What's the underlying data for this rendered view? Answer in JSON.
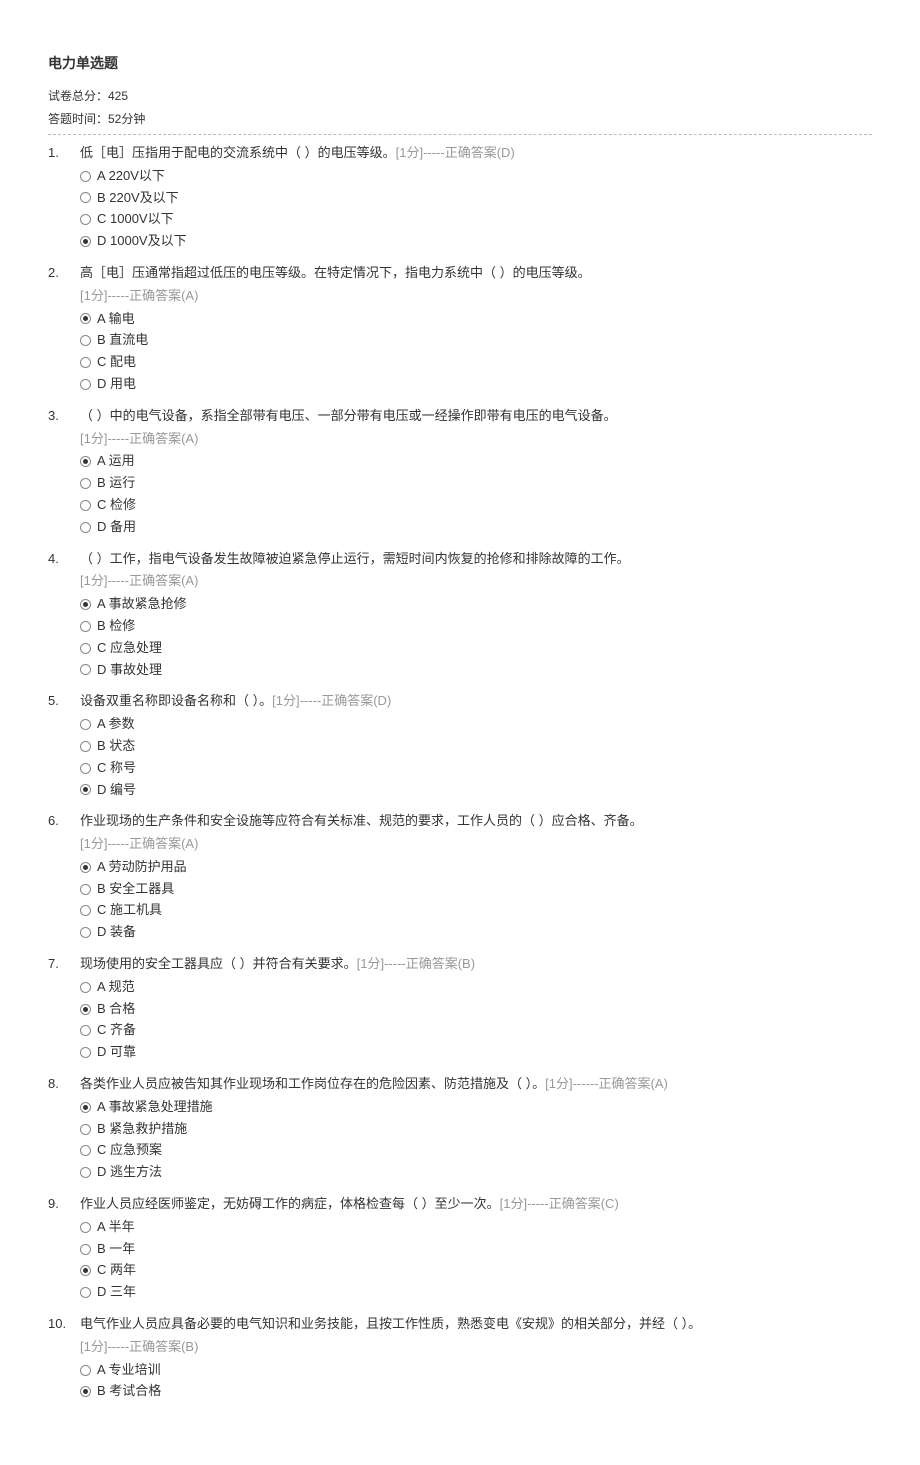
{
  "title": "电力单选题",
  "meta": {
    "total_score_label": "试卷总分：425",
    "time_label": "答题时间：52分钟"
  },
  "questions": [
    {
      "num": "1.",
      "stem": "低［电］压指用于配电的交流系统中（  ）的电压等级。",
      "answer": "[1分]-----正确答案(D)",
      "answer_inline": true,
      "options": [
        {
          "letter": "A",
          "text": "220V以下",
          "selected": false
        },
        {
          "letter": "B",
          "text": "220V及以下",
          "selected": false
        },
        {
          "letter": "C",
          "text": "1000V以下",
          "selected": false
        },
        {
          "letter": "D",
          "text": "1000V及以下",
          "selected": true
        }
      ]
    },
    {
      "num": "2.",
      "stem": "高［电］压通常指超过低压的电压等级。在特定情况下，指电力系统中（  ）的电压等级。",
      "answer": "[1分]-----正确答案(A)",
      "answer_inline": false,
      "options": [
        {
          "letter": "A",
          "text": "输电",
          "selected": true
        },
        {
          "letter": "B",
          "text": "直流电",
          "selected": false
        },
        {
          "letter": "C",
          "text": "配电",
          "selected": false
        },
        {
          "letter": "D",
          "text": "用电",
          "selected": false
        }
      ]
    },
    {
      "num": "3.",
      "stem": "（  ）中的电气设备，系指全部带有电压、一部分带有电压或一经操作即带有电压的电气设备。",
      "answer": "[1分]-----正确答案(A)",
      "answer_inline": false,
      "options": [
        {
          "letter": "A",
          "text": "运用",
          "selected": true
        },
        {
          "letter": "B",
          "text": "运行",
          "selected": false
        },
        {
          "letter": "C",
          "text": "检修",
          "selected": false
        },
        {
          "letter": "D",
          "text": "备用",
          "selected": false
        }
      ]
    },
    {
      "num": "4.",
      "stem": "（  ）工作，指电气设备发生故障被迫紧急停止运行，需短时间内恢复的抢修和排除故障的工作。",
      "answer": "[1分]-----正确答案(A)",
      "answer_inline": false,
      "options": [
        {
          "letter": "A",
          "text": "事故紧急抢修",
          "selected": true
        },
        {
          "letter": "B",
          "text": "检修",
          "selected": false
        },
        {
          "letter": "C",
          "text": "应急处理",
          "selected": false
        },
        {
          "letter": "D",
          "text": "事故处理",
          "selected": false
        }
      ]
    },
    {
      "num": "5.",
      "stem": "设备双重名称即设备名称和（  ）。",
      "answer": "[1分]-----正确答案(D)",
      "answer_inline": true,
      "options": [
        {
          "letter": "A",
          "text": "参数",
          "selected": false
        },
        {
          "letter": "B",
          "text": "状态",
          "selected": false
        },
        {
          "letter": "C",
          "text": "称号",
          "selected": false
        },
        {
          "letter": "D",
          "text": "编号",
          "selected": true
        }
      ]
    },
    {
      "num": "6.",
      "stem": "作业现场的生产条件和安全设施等应符合有关标准、规范的要求，工作人员的（  ）应合格、齐备。",
      "answer": "[1分]-----正确答案(A)",
      "answer_inline": false,
      "options": [
        {
          "letter": "A",
          "text": "劳动防护用品",
          "selected": true
        },
        {
          "letter": "B",
          "text": "安全工器具",
          "selected": false
        },
        {
          "letter": "C",
          "text": "施工机具",
          "selected": false
        },
        {
          "letter": "D",
          "text": "装备",
          "selected": false
        }
      ]
    },
    {
      "num": "7.",
      "stem": "现场使用的安全工器具应（  ）并符合有关要求。",
      "answer": "[1分]-----正确答案(B)",
      "answer_inline": true,
      "options": [
        {
          "letter": "A",
          "text": "规范",
          "selected": false
        },
        {
          "letter": "B",
          "text": "合格",
          "selected": true
        },
        {
          "letter": "C",
          "text": "齐备",
          "selected": false
        },
        {
          "letter": "D",
          "text": "可靠",
          "selected": false
        }
      ]
    },
    {
      "num": "8.",
      "stem": "各类作业人员应被告知其作业现场和工作岗位存在的危险因素、防范措施及（  ）。",
      "answer": "[1分]------正确答案(A)",
      "answer_inline": true,
      "options": [
        {
          "letter": "A",
          "text": "事故紧急处理措施",
          "selected": true
        },
        {
          "letter": "B",
          "text": "紧急救护措施",
          "selected": false
        },
        {
          "letter": "C",
          "text": "应急预案",
          "selected": false
        },
        {
          "letter": "D",
          "text": "逃生方法",
          "selected": false
        }
      ]
    },
    {
      "num": "9.",
      "stem": "作业人员应经医师鉴定，无妨碍工作的病症，体格检查每（  ）至少一次。",
      "answer": "[1分]-----正确答案(C)",
      "answer_inline": true,
      "options": [
        {
          "letter": "A",
          "text": "半年",
          "selected": false
        },
        {
          "letter": "B",
          "text": "一年",
          "selected": false
        },
        {
          "letter": "C",
          "text": "两年",
          "selected": true
        },
        {
          "letter": "D",
          "text": "三年",
          "selected": false
        }
      ]
    },
    {
      "num": "10.",
      "stem": "电气作业人员应具备必要的电气知识和业务技能，且按工作性质，熟悉变电《安规》的相关部分，并经（  ）。",
      "answer": "[1分]-----正确答案(B)",
      "answer_inline": false,
      "options": [
        {
          "letter": "A",
          "text": "专业培训",
          "selected": false
        },
        {
          "letter": "B",
          "text": "考试合格",
          "selected": true
        }
      ]
    }
  ]
}
